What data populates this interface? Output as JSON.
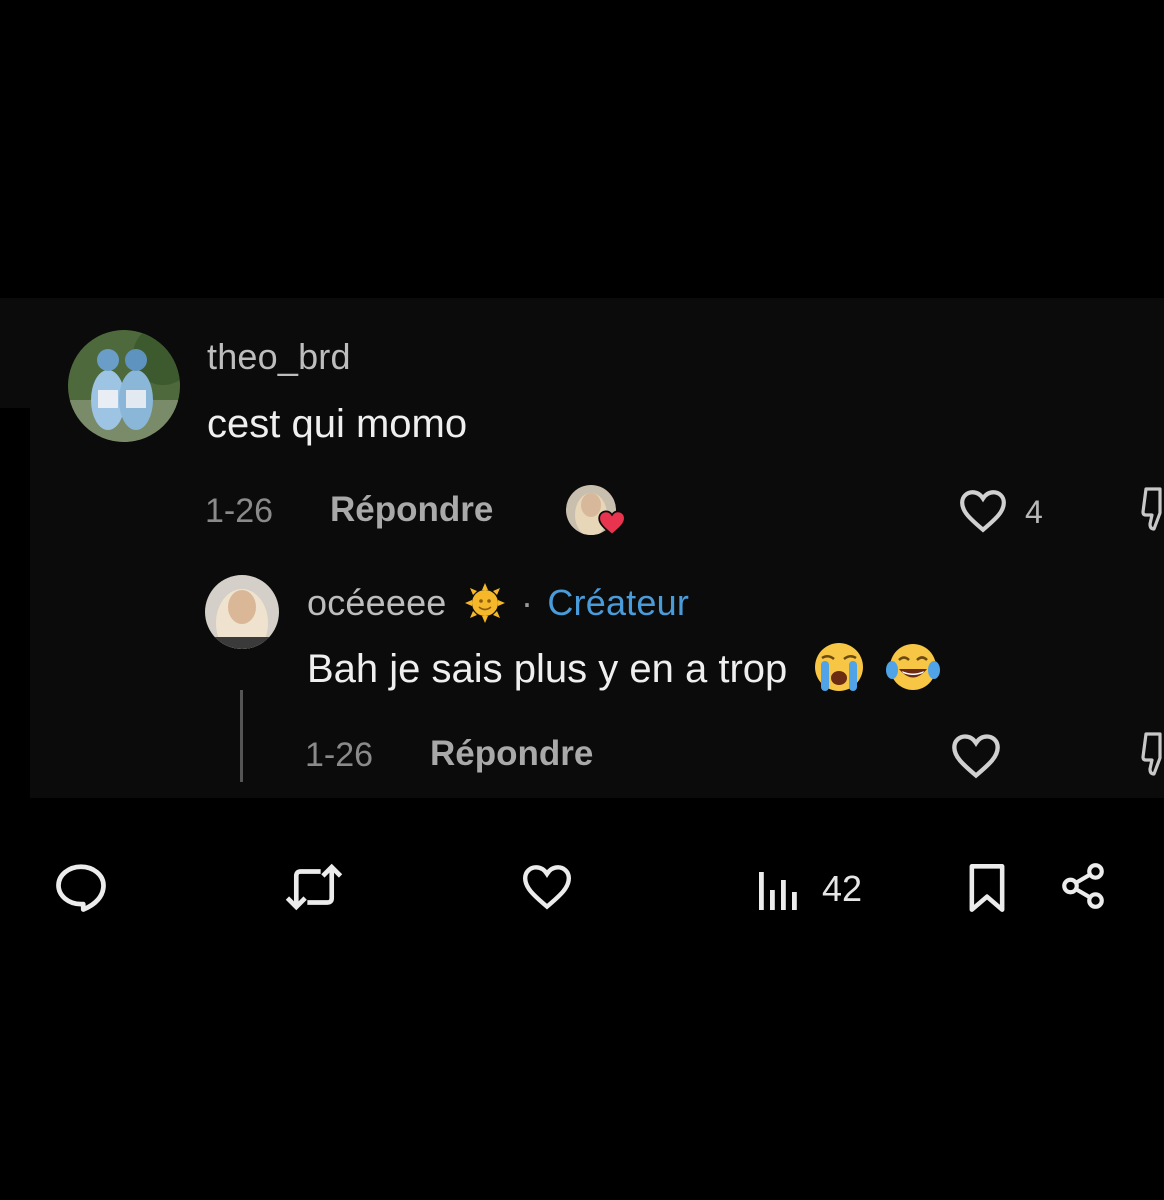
{
  "comments": [
    {
      "username": "theo_brd",
      "text": "cest qui momo",
      "date": "1-26",
      "reply_label": "Répondre",
      "likes": "4"
    },
    {
      "username": "océeeee",
      "badge": "Créateur",
      "text": "Bah je sais plus y en a trop",
      "date": "1-26",
      "reply_label": "Répondre"
    }
  ],
  "post_actions": {
    "views": "42"
  },
  "icons": {
    "reply": "speech-bubble-icon",
    "repost": "repost-arrows-icon",
    "like": "heart-icon",
    "views": "bar-chart-icon",
    "bookmark": "bookmark-icon",
    "share": "share-icon",
    "dislike": "thumbs-down-icon",
    "creator_emoji": "sun-emoji",
    "crying": "loudly-crying-emoji",
    "laughing": "tears-of-joy-emoji"
  },
  "colors": {
    "creator_badge": "#4a9bd9",
    "heart_badge": "#e8344e"
  }
}
